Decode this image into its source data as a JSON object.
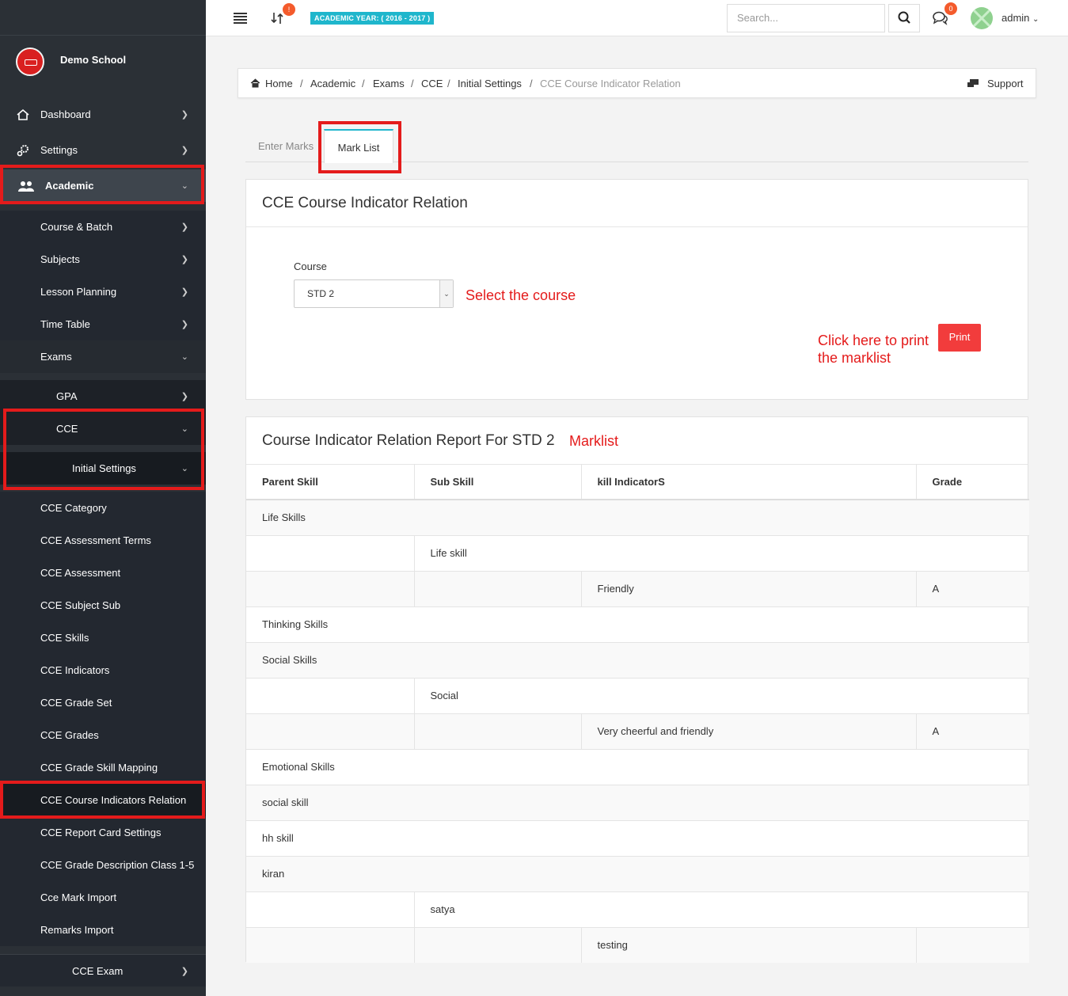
{
  "sidebar": {
    "school_name": "Demo School",
    "dashboard": "Dashboard",
    "settings": "Settings",
    "academic": "Academic",
    "course_batch": "Course & Batch",
    "subjects": "Subjects",
    "lesson_planning": "Lesson Planning",
    "time_table": "Time Table",
    "exams": "Exams",
    "gpa": "GPA",
    "cce": "CCE",
    "initial_settings": "Initial Settings",
    "cce_items": [
      "CCE Category",
      "CCE Assessment Terms",
      "CCE Assessment",
      "CCE Subject Sub",
      "CCE Skills",
      "CCE Indicators",
      "CCE Grade Set",
      "CCE Grades",
      "CCE Grade Skill Mapping",
      "CCE Course Indicators Relation",
      "CCE Report Card Settings",
      "CCE Grade Description Class 1-5",
      "Cce Mark Import",
      "Remarks Import"
    ],
    "cce_exam": "CCE Exam"
  },
  "topbar": {
    "notif_badge": "!",
    "academic_year": "ACADEMIC YEAR: ( 2016 - 2017 )",
    "search_placeholder": "Search...",
    "chat_badge": "0",
    "user": "admin"
  },
  "breadcrumb": {
    "items": [
      "Home",
      "Academic",
      "Exams",
      "CCE",
      "Initial Settings"
    ],
    "current": "CCE Course Indicator Relation",
    "support": "Support"
  },
  "tabs": [
    "Enter Marks",
    "Mark List"
  ],
  "form_panel": {
    "title": "CCE Course Indicator Relation",
    "course_label": "Course",
    "course_value": "STD 2",
    "print_label": "Print"
  },
  "annotations": {
    "select_course": "Select the course",
    "print_line1": "Click here to print",
    "print_line2": "the marklist",
    "marklist": "Marklist"
  },
  "report": {
    "title": "Course Indicator Relation Report For STD 2",
    "columns": [
      "Parent Skill",
      "Sub Skill",
      "kill IndicatorS",
      "Grade"
    ],
    "rows": [
      {
        "type": "parent",
        "text": "Life Skills"
      },
      {
        "type": "sub",
        "text": "Life skill"
      },
      {
        "type": "ind",
        "text": "Friendly",
        "grade": "A"
      },
      {
        "type": "parent",
        "text": "Thinking Skills"
      },
      {
        "type": "parent",
        "text": "Social Skills"
      },
      {
        "type": "sub",
        "text": "Social"
      },
      {
        "type": "ind",
        "text": "Very cheerful and friendly",
        "grade": "A"
      },
      {
        "type": "parent",
        "text": "Emotional Skills"
      },
      {
        "type": "parent",
        "text": "social skill"
      },
      {
        "type": "parent",
        "text": "hh skill"
      },
      {
        "type": "parent",
        "text": "kiran"
      },
      {
        "type": "sub",
        "text": "satya"
      },
      {
        "type": "ind",
        "text": "testing",
        "grade": ""
      }
    ]
  },
  "colors": {
    "sidebar_bg": "#2b3036",
    "accent_teal": "#1fb6cc",
    "print_red": "#f23c3c",
    "annotation_red": "#e41b1b"
  }
}
